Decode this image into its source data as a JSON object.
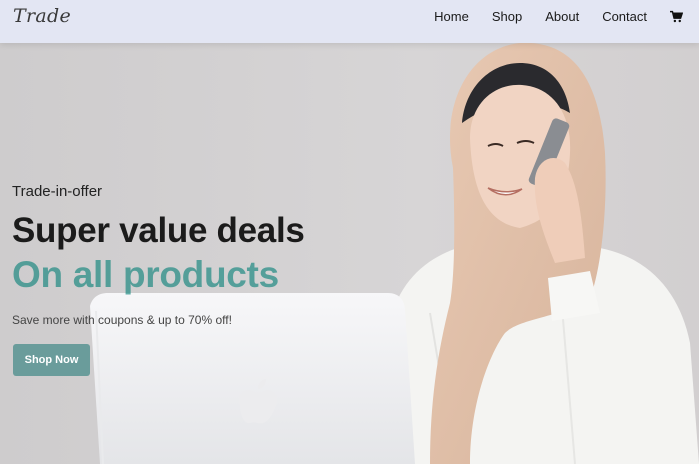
{
  "brand": {
    "logo_text": "Trade"
  },
  "nav": {
    "items": [
      {
        "label": "Home"
      },
      {
        "label": "Shop"
      },
      {
        "label": "About"
      },
      {
        "label": "Contact"
      }
    ],
    "cart_icon": "cart-icon"
  },
  "hero": {
    "eyebrow": "Trade-in-offer",
    "headline": "Super value deals",
    "highlight": "On all products",
    "subtext": "Save more with coupons & up to 70% off!",
    "cta_label": "Shop Now",
    "image": "woman-on-phone-with-laptop"
  },
  "colors": {
    "nav_bg": "#e3e6f3",
    "accent": "#088178",
    "cta_bg": "#6a9c9b",
    "headline": "#1b1b1b"
  }
}
